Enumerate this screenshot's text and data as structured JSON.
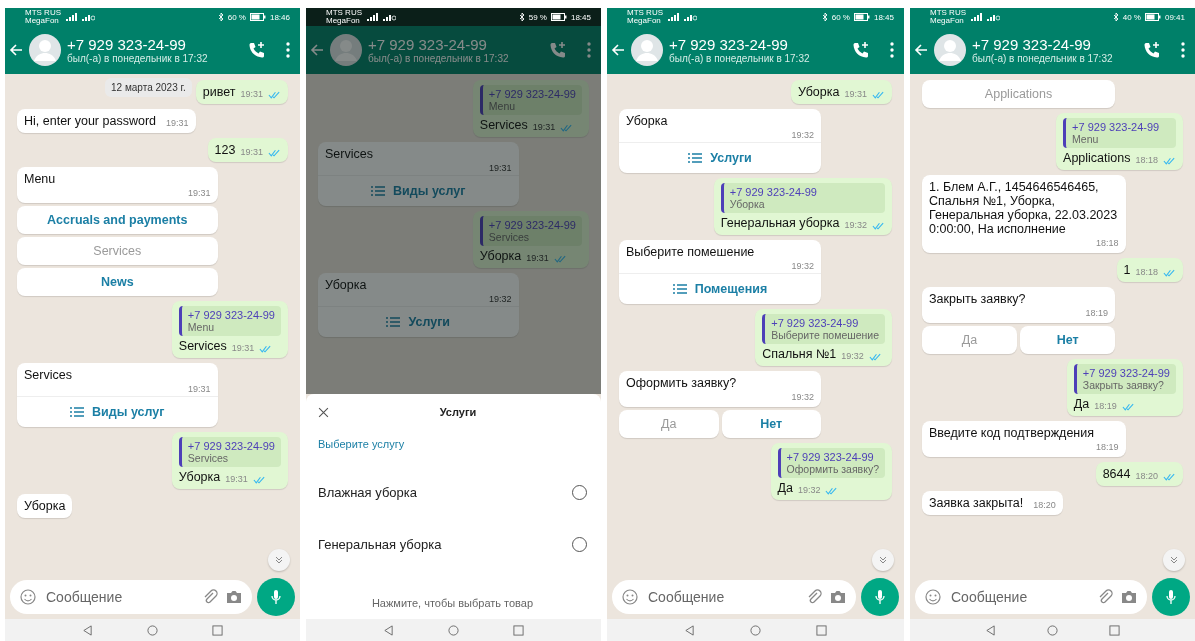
{
  "screens": [
    {
      "status_bar": {
        "carrier": [
          "MTS RUS",
          "MegaFon"
        ],
        "battery": "60 %",
        "time": "18:46"
      },
      "header": {
        "name": "+7 929 323-24-99",
        "last_seen": "был(-а) в понедельник в 17:32"
      },
      "dimmed": false,
      "date_chip": "12 марта 2023 г.",
      "scroll_down": true,
      "messages": [
        {
          "kind": "out",
          "text": "ривет",
          "time": "19:31",
          "read": true
        },
        {
          "kind": "in",
          "text": "Hi, enter your password",
          "time": "19:31"
        },
        {
          "kind": "out",
          "text": "123",
          "time": "19:31",
          "read": true
        },
        {
          "kind": "in",
          "text": "Menu",
          "time": "19:31",
          "buttons": [
            {
              "label": "Accruals and payments",
              "disabled": false
            },
            {
              "label": "Services",
              "disabled": true
            },
            {
              "label": "News",
              "disabled": false
            }
          ]
        },
        {
          "kind": "out",
          "quote": {
            "author": "+7 929 323-24-99",
            "text": "Menu"
          },
          "text": "Services",
          "time": "19:31",
          "read": true
        },
        {
          "kind": "in",
          "text": "Services",
          "time": "19:31",
          "list_button": "Виды услуг"
        },
        {
          "kind": "out",
          "quote": {
            "author": "+7 929 323-24-99",
            "text": "Services"
          },
          "text": "Уборка",
          "time": "19:31",
          "read": true
        },
        {
          "kind": "in",
          "text": "Уборка"
        }
      ],
      "composer": {
        "placeholder": "Сообщение"
      }
    },
    {
      "status_bar": {
        "carrier": [
          "MTS RUS",
          "MegaFon"
        ],
        "battery": "59 %",
        "time": "18:45"
      },
      "header": {
        "name": "+7 929 323-24-99",
        "last_seen": "был(-а) в понедельник в 17:32"
      },
      "dimmed": true,
      "scroll_down": false,
      "messages": [
        {
          "kind": "out",
          "quote": {
            "author": "+7 929 323-24-99",
            "text": "Menu"
          },
          "text": "Services",
          "time": "19:31",
          "read": true
        },
        {
          "kind": "in",
          "text": "Services",
          "time": "19:31",
          "list_button": "Виды услуг"
        },
        {
          "kind": "out",
          "quote": {
            "author": "+7 929 323-24-99",
            "text": "Services"
          },
          "text": "Уборка",
          "time": "19:31",
          "read": true
        },
        {
          "kind": "in",
          "text": "Уборка",
          "time": "19:32",
          "list_button": "Услуги"
        }
      ],
      "sheet": {
        "title": "Услуги",
        "subtitle": "Выберите услугу",
        "options": [
          {
            "label": "Влажная уборка",
            "selected": false
          },
          {
            "label": "Генеральная уборка",
            "selected": false
          }
        ],
        "footer": "Нажмите, чтобы выбрать товар"
      }
    },
    {
      "status_bar": {
        "carrier": [
          "MTS RUS",
          "MegaFon"
        ],
        "battery": "60 %",
        "time": "18:45"
      },
      "header": {
        "name": "+7 929 323-24-99",
        "last_seen": "был(-а) в понедельник в 17:32"
      },
      "dimmed": false,
      "scroll_down": true,
      "messages": [
        {
          "kind": "out",
          "text": "Уборка",
          "time": "19:31",
          "read": true
        },
        {
          "kind": "in",
          "text": "Уборка",
          "time": "19:32",
          "list_button": "Услуги"
        },
        {
          "kind": "out",
          "quote": {
            "author": "+7 929 323-24-99",
            "text": "Уборка"
          },
          "text": "Генеральная уборка",
          "time": "19:32",
          "read": true
        },
        {
          "kind": "in",
          "text": "Выберите помешение",
          "time": "19:32",
          "list_button": "Помещения"
        },
        {
          "kind": "out",
          "quote": {
            "author": "+7 929 323-24-99",
            "text": "Выберите помешение"
          },
          "text": "Спальня №1",
          "time": "19:32",
          "read": true
        },
        {
          "kind": "in",
          "text": "Оформить заявку?",
          "time": "19:32",
          "buttons": [
            {
              "label": "Да",
              "disabled": true
            },
            {
              "label": "Нет",
              "disabled": false
            }
          ]
        },
        {
          "kind": "out",
          "quote": {
            "author": "+7 929 323-24-99",
            "text": "Оформить заявку?"
          },
          "text": "Да",
          "time": "19:32",
          "read": true
        }
      ],
      "composer": {
        "placeholder": "Сообщение"
      }
    },
    {
      "status_bar": {
        "carrier": [
          "MTS RUS",
          "MegaFon"
        ],
        "battery": "40 %",
        "time": "09:41"
      },
      "header": {
        "name": "+7 929 323-24-99",
        "last_seen": "был(-а) в понедельник в 17:32"
      },
      "dimmed": false,
      "scroll_down": true,
      "messages": [
        {
          "kind": "in",
          "buttons": [
            {
              "label": "Applications",
              "disabled": true
            }
          ]
        },
        {
          "kind": "out",
          "quote": {
            "author": "+7 929 323-24-99",
            "text": "Menu"
          },
          "text": "Applications",
          "time": "18:18",
          "read": true
        },
        {
          "kind": "in",
          "text": "1. Блем А.Г., 1454646546465, Спальня №1, Уборка, Генеральная уборка, 22.03.2023 0:00:00, На исполнение",
          "time": "18:18"
        },
        {
          "kind": "out",
          "text": "1",
          "time": "18:18",
          "read": true
        },
        {
          "kind": "in",
          "text": "Закрыть заявку?",
          "time": "18:19",
          "buttons": [
            {
              "label": "Да",
              "disabled": true
            },
            {
              "label": "Нет",
              "disabled": false
            }
          ]
        },
        {
          "kind": "out",
          "quote": {
            "author": "+7 929 323-24-99",
            "text": "Закрыть заявку?"
          },
          "text": "Да",
          "time": "18:19",
          "read": true
        },
        {
          "kind": "in",
          "text": "Введите код подтверждения",
          "time": "18:19"
        },
        {
          "kind": "out",
          "text": "8644",
          "time": "18:20",
          "read": true
        },
        {
          "kind": "in",
          "text": "Заявка закрыта!",
          "time": "18:20"
        }
      ],
      "composer": {
        "placeholder": "Сообщение"
      }
    }
  ]
}
